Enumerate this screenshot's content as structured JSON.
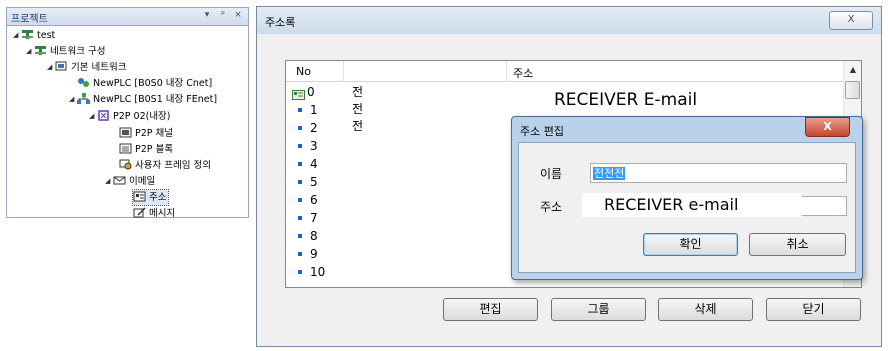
{
  "project_panel": {
    "title": "프로젝트",
    "header_icons": [
      "▾",
      "ᵖ",
      "×"
    ],
    "tree": [
      {
        "label": "test",
        "icon": "project-icon"
      },
      {
        "label": "네트워크 구성",
        "icon": "network-config-icon"
      },
      {
        "label": "기본 네트워크",
        "icon": "basic-network-icon"
      },
      {
        "label": "NewPLC [B0S0 내장 Cnet]",
        "icon": "plc-cnet-icon"
      },
      {
        "label": "NewPLC [B0S1 내장 FEnet]",
        "icon": "plc-fenet-icon"
      },
      {
        "label": "P2P 02(내장)",
        "icon": "p2p-icon"
      },
      {
        "label": "P2P 채널",
        "icon": "p2p-channel-icon"
      },
      {
        "label": "P2P 블록",
        "icon": "p2p-block-icon"
      },
      {
        "label": "사용자 프레임 정의",
        "icon": "user-frame-icon"
      },
      {
        "label": "이메일",
        "icon": "email-icon"
      },
      {
        "label": "주소",
        "icon": "address-book-icon"
      },
      {
        "label": "메시지",
        "icon": "message-icon"
      }
    ]
  },
  "address_dialog": {
    "title": "주소록",
    "close_glyph": "X",
    "columns": [
      "No",
      "주소"
    ],
    "rows": [
      {
        "no": "0",
        "name": "전전전"
      },
      {
        "no": "1"
      },
      {
        "no": "2"
      },
      {
        "no": "3"
      },
      {
        "no": "4"
      },
      {
        "no": "5"
      },
      {
        "no": "6"
      },
      {
        "no": "7"
      },
      {
        "no": "8"
      },
      {
        "no": "9"
      },
      {
        "no": "10"
      }
    ],
    "receiver_overlay": "RECEIVER E-mail",
    "buttons": {
      "edit": "편집",
      "group": "그룹",
      "delete": "삭제",
      "close": "닫기"
    }
  },
  "edit_dialog": {
    "title": "주소 편집",
    "close_glyph": "X",
    "name_label": "이름",
    "name_value": "전전전",
    "address_label": "주소",
    "address_overlay": "RECEIVER e-mail",
    "ok": "확인",
    "cancel": "취소"
  },
  "colors": {
    "titlebar": "#ccdaea",
    "popup_frame": "#b9d1ea",
    "close_red": "#c7452c",
    "bullet": "#1a5fd6",
    "selection": "#3399ff"
  }
}
